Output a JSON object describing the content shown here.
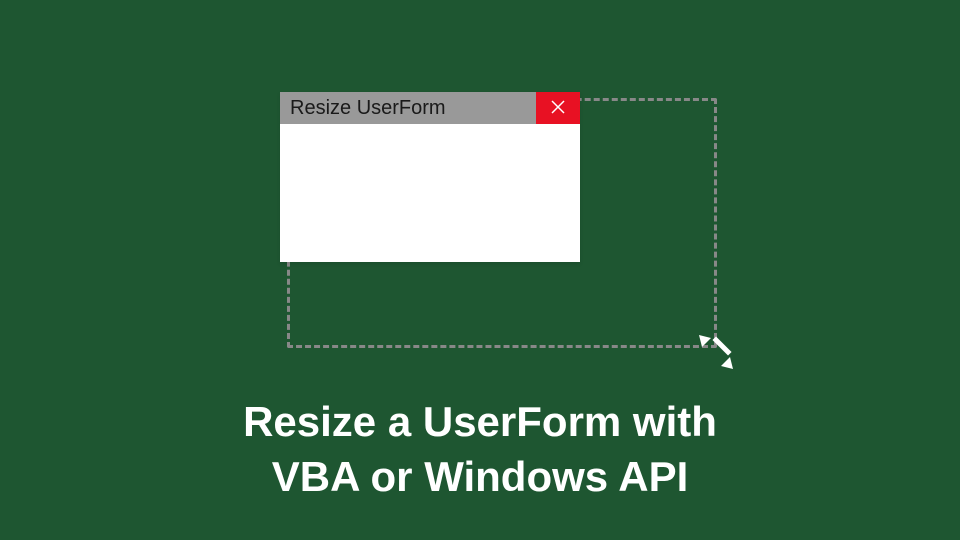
{
  "window": {
    "title": "Resize UserForm"
  },
  "headline": {
    "line1": "Resize a UserForm with",
    "line2": "VBA or Windows API"
  }
}
